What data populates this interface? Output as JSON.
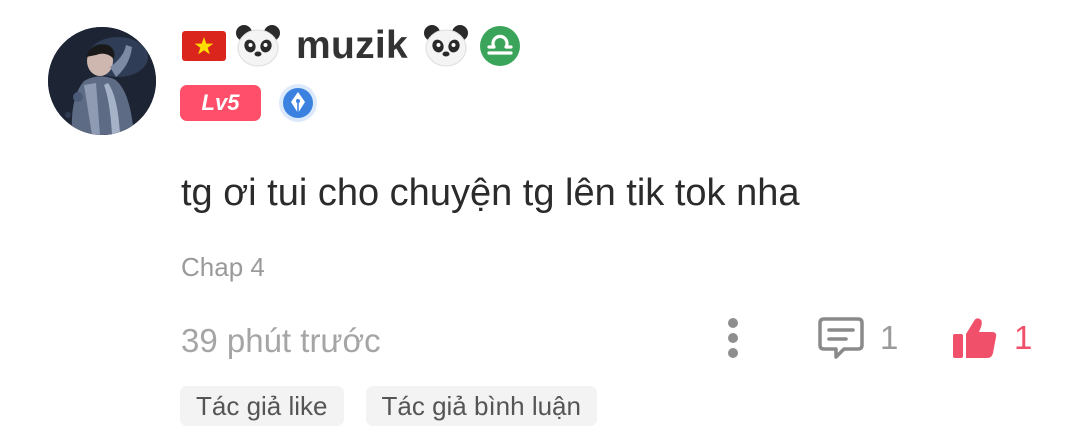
{
  "user": {
    "name": "muzik",
    "level_badge": "Lv5",
    "avatar_icon": "avatar-photo",
    "name_prefix_icons": [
      "vietnam-flag-icon",
      "panda-icon"
    ],
    "name_suffix_icons": [
      "panda-icon",
      "libra-icon"
    ],
    "author_badge_icon": "pen-nib-badge-icon"
  },
  "comment": {
    "text": "tg ơi tui cho chuyện tg lên tik tok nha",
    "chapter": "Chap 4",
    "time": "39 phút trước"
  },
  "actions": {
    "more_icon": "more-vertical-icon",
    "reply_icon": "comment-icon",
    "reply_count": "1",
    "like_icon": "thumbs-up-icon",
    "like_count": "1",
    "like_color": "#f0506a"
  },
  "tags": [
    "Tác giả like",
    "Tác giả bình luận"
  ],
  "colors": {
    "level_badge": "#ff4f6a",
    "muted_text": "#9a9a9a",
    "tag_bg": "#f3f3f3"
  }
}
